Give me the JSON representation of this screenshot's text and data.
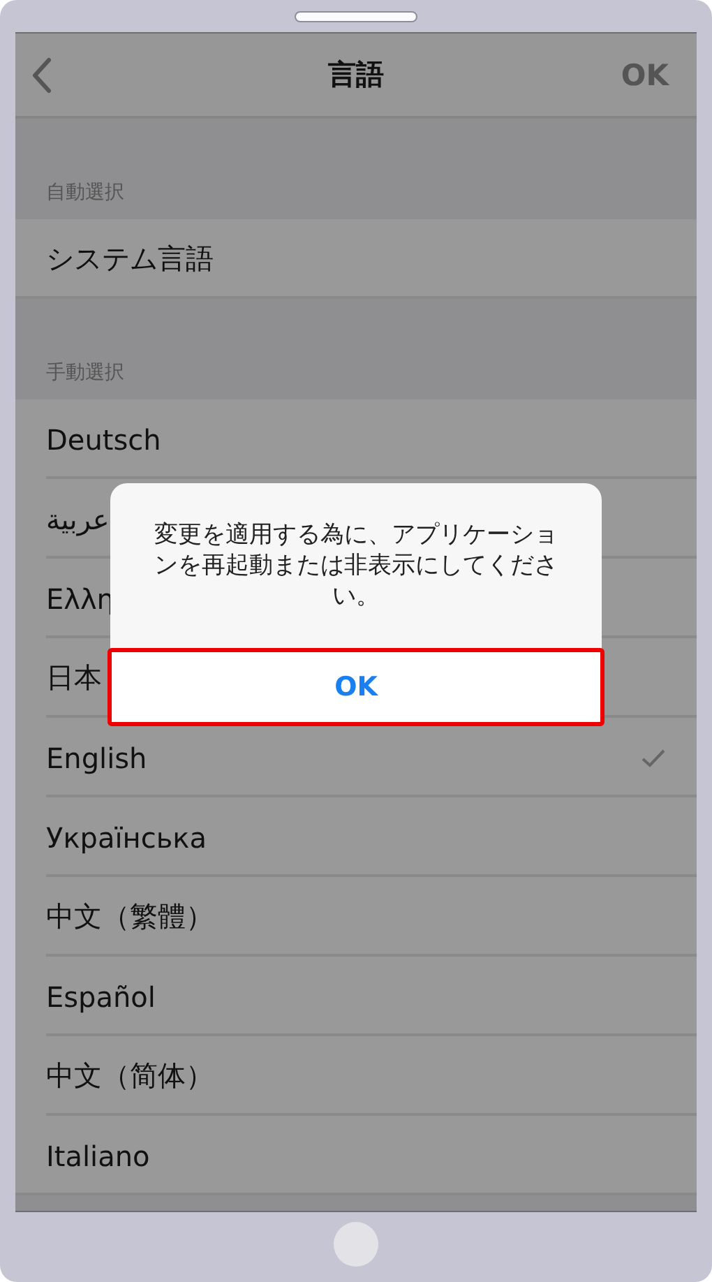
{
  "nav": {
    "title": "言語",
    "done": "OK"
  },
  "sections": [
    {
      "header": "自動選択",
      "items": [
        {
          "label": "システム言語",
          "selected": false
        }
      ]
    },
    {
      "header": "手動選択",
      "items": [
        {
          "label": "Deutsch",
          "selected": false
        },
        {
          "label": "عربية",
          "selected": false
        },
        {
          "label": "Ελλη",
          "selected": false
        },
        {
          "label": "日本",
          "selected": false
        },
        {
          "label": "English",
          "selected": true
        },
        {
          "label": "Українська",
          "selected": false
        },
        {
          "label": "中文（繁體）",
          "selected": false
        },
        {
          "label": "Español",
          "selected": false
        },
        {
          "label": "中文（简体）",
          "selected": false
        },
        {
          "label": "Italiano",
          "selected": false
        }
      ]
    }
  ],
  "alert": {
    "message": "変更を適用する為に、アプリケーションを再起動または非表示にしてください。",
    "button": "OK",
    "highlighted": true
  }
}
